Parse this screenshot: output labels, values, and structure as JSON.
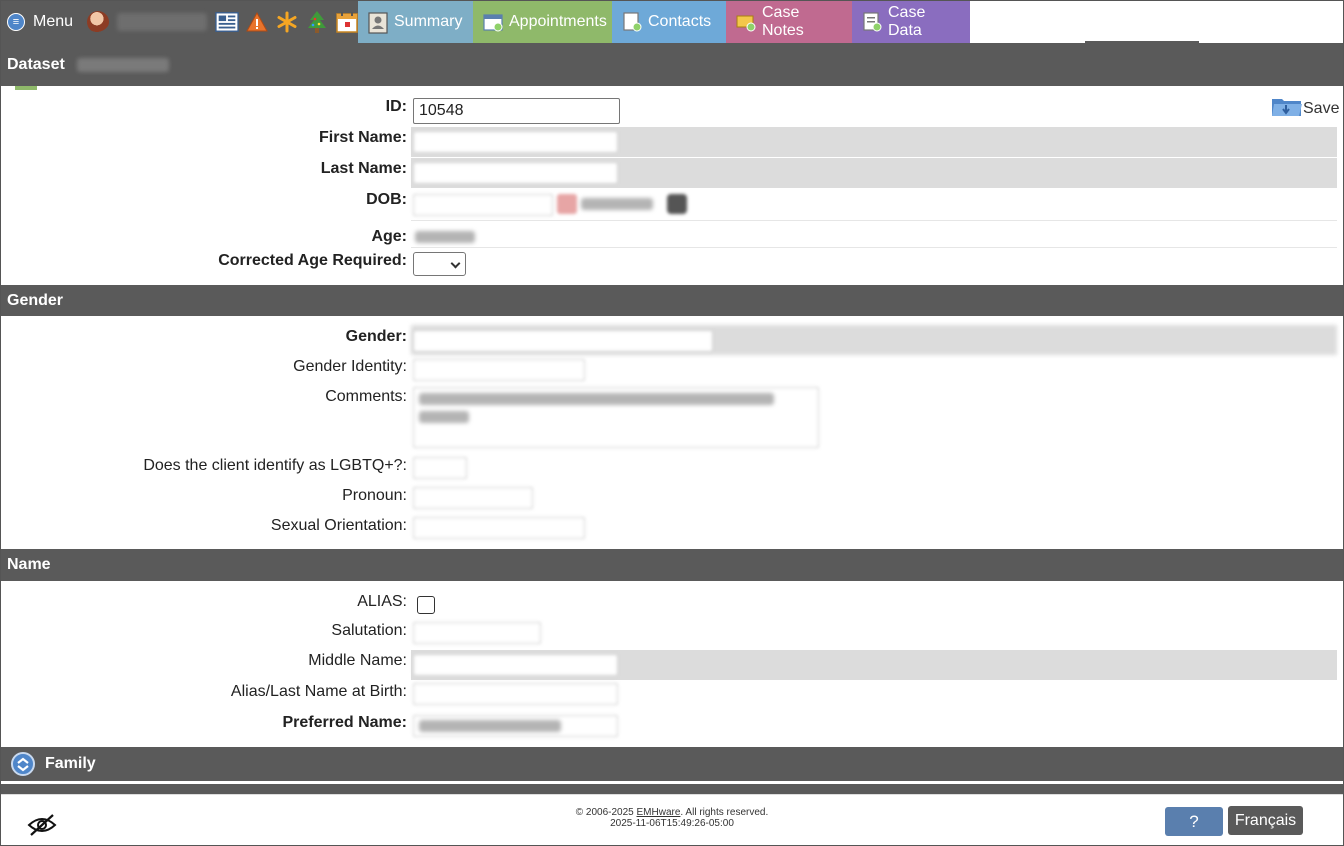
{
  "nav": {
    "menu_label": "Menu",
    "tabs": [
      {
        "label": "Summary"
      },
      {
        "label": "Appointments"
      },
      {
        "label": "Contacts"
      },
      {
        "label": "Case Notes"
      },
      {
        "label": "Case Data"
      }
    ],
    "quick_icons": [
      "dashboard-icon",
      "alert-icon",
      "asterisk-icon",
      "tree-icon",
      "calendar-icon"
    ]
  },
  "dataset": {
    "header": "Dataset",
    "id_label": "ID:",
    "id_value": "10548",
    "save_label": "Save",
    "first_name_label": "First Name:",
    "last_name_label": "Last Name:",
    "dob_label": "DOB:",
    "age_label": "Age:",
    "corrected_age_label": "Corrected Age Required:"
  },
  "gender": {
    "header": "Gender",
    "gender_label": "Gender:",
    "identity_label": "Gender Identity:",
    "comments_label": "Comments:",
    "lgbtq_label": "Does the client identify as LGBTQ+?:",
    "pronoun_label": "Pronoun:",
    "orientation_label": "Sexual Orientation:"
  },
  "name": {
    "header": "Name",
    "alias_label": "ALIAS:",
    "salutation_label": "Salutation:",
    "middle_name_label": "Middle Name:",
    "alias_birth_label": "Alias/Last Name at Birth:",
    "preferred_label": "Preferred Name:"
  },
  "family": {
    "header": "Family"
  },
  "footer": {
    "copyright_prefix": "© 2006-2025 ",
    "company": "EMHware",
    "copyright_suffix": ". All rights reserved.",
    "timestamp": "2025-11-06T15:49:26-05:00",
    "help_label": "?",
    "language_label": "Français"
  },
  "colors": {
    "header_bg": "#5a5a5a",
    "summary_tab": "#7eaec6",
    "appointments_tab": "#8fb96a",
    "contacts_tab": "#6ea9d8",
    "casenotes_tab": "#c06a90",
    "casedata_tab": "#8a6dbf",
    "help_button": "#5a7fae"
  }
}
